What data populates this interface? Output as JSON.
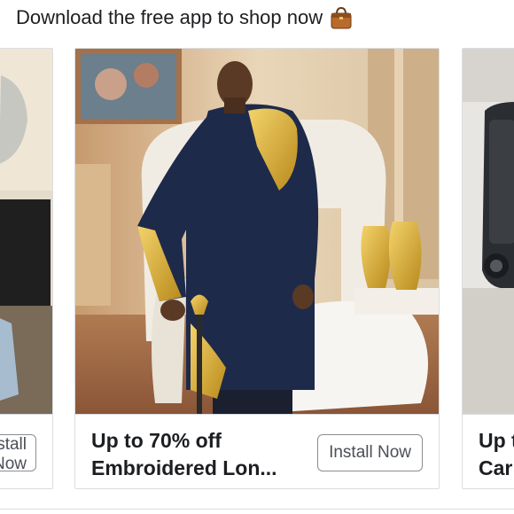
{
  "header": {
    "text": "Download the free app to shop now",
    "icon": "handbag-icon"
  },
  "cards": {
    "left": {
      "button_label": "Install Now"
    },
    "main": {
      "title_line1": "Up to 70% off",
      "title_line2": "Embroidered Lon...",
      "button_label": "Install Now"
    },
    "right": {
      "title_line1": "Up t",
      "title_line2": "Car"
    }
  },
  "colors": {
    "text": "#1c1e21",
    "border": "#dadde1",
    "button_text": "#4b4f56"
  }
}
